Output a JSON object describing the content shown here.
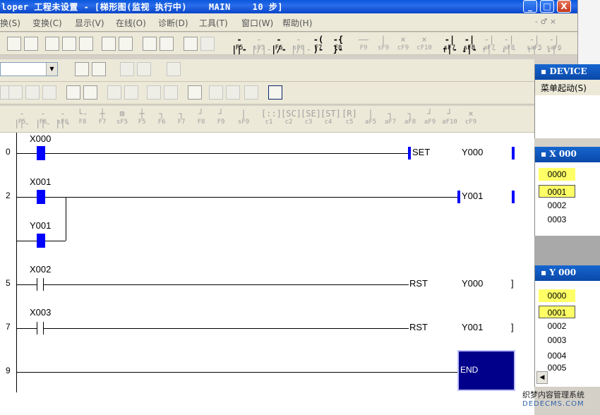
{
  "window": {
    "title": "loper 工程未设置 - [梯形图(监视 执行中)    MAIN    10 步]",
    "controls": {
      "minimize": "_",
      "maximize": "□",
      "close": "X"
    }
  },
  "menu": {
    "items": [
      "换(S)",
      "变换(C)",
      "显示(V)",
      "在线(O)",
      "诊断(D)",
      "工具(T)",
      "窗口(W)",
      "帮助(H)"
    ],
    "mdi_controls": "- ♂ ×"
  },
  "toolbar_fkeys": [
    {
      "sym": "-||-",
      "label": "F5",
      "enabled": true
    },
    {
      "sym": "-|/|-",
      "label": "sF5",
      "enabled": false
    },
    {
      "sym": "-|/-",
      "label": "F6",
      "enabled": true
    },
    {
      "sym": "-|/|-",
      "label": "sF6",
      "enabled": false
    },
    {
      "sym": "-( )-",
      "label": "F7",
      "enabled": true
    },
    {
      "sym": "-{ }-",
      "label": "F8",
      "enabled": true
    },
    {
      "sym": "——",
      "label": "F9",
      "enabled": false
    },
    {
      "sym": "|",
      "label": "sF9",
      "enabled": false
    },
    {
      "sym": "×",
      "label": "cF9",
      "enabled": false
    },
    {
      "sym": "×",
      "label": "cF10",
      "enabled": false
    },
    {
      "sym": "-|↑|-",
      "label": "sF7",
      "enabled": true
    },
    {
      "sym": "-|↓|-",
      "label": "sF8",
      "enabled": true
    },
    {
      "sym": "-|↑|-",
      "label": "aF7",
      "enabled": false
    },
    {
      "sym": "-|↓|-",
      "label": "aF8",
      "enabled": false
    },
    {
      "sym": "-|↑|-",
      "label": "saF5",
      "enabled": false
    },
    {
      "sym": "-|↓|-",
      "label": "saF6",
      "enabled": false
    }
  ],
  "toolbar_row4": [
    {
      "sym": "-||-",
      "label": "F5"
    },
    {
      "sym": "-||-",
      "label": "F6"
    },
    {
      "sym": "-||-",
      "label": "sF6"
    },
    {
      "sym": "└-",
      "label": "F8"
    },
    {
      "sym": "┼",
      "label": "F7"
    },
    {
      "sym": "⊠",
      "label": "sF5"
    },
    {
      "sym": "┼",
      "label": "F5"
    },
    {
      "sym": "┐",
      "label": "F6"
    },
    {
      "sym": "┐",
      "label": "F7"
    },
    {
      "sym": "┘",
      "label": "F8"
    },
    {
      "sym": "┘",
      "label": "F9"
    },
    {
      "sym": "|",
      "label": "sF9"
    },
    {
      "sym": "[::]",
      "label": "c1"
    },
    {
      "sym": "[SC]",
      "label": "c2"
    },
    {
      "sym": "[SE]",
      "label": "c3"
    },
    {
      "sym": "[ST]",
      "label": "c4"
    },
    {
      "sym": "[R]",
      "label": "c5"
    },
    {
      "sym": "|",
      "label": "aF5"
    },
    {
      "sym": "┐",
      "label": "aF7"
    },
    {
      "sym": "┐",
      "label": "aF8"
    },
    {
      "sym": "┘",
      "label": "aF9"
    },
    {
      "sym": "┘",
      "label": "aF10"
    },
    {
      "sym": "×",
      "label": "cF9"
    }
  ],
  "ladder": {
    "rungs": [
      {
        "step": "0",
        "contacts": [
          "X000"
        ],
        "instruction": "SET",
        "operand": "Y000"
      },
      {
        "step": "2",
        "contacts": [
          "X001",
          "Y001"
        ],
        "coil": "Y001"
      },
      {
        "step": "5",
        "contacts": [
          "X002"
        ],
        "instruction": "RST",
        "operand": "Y000"
      },
      {
        "step": "7",
        "contacts": [
          "X003"
        ],
        "instruction": "RST",
        "operand": "Y001"
      },
      {
        "step": "9",
        "instruction": "END"
      }
    ]
  },
  "device_panel": {
    "title": "DEVICE",
    "menu": "菜单起动(S)"
  },
  "x_panel": {
    "title": "X  000",
    "items": [
      "0000",
      "0001",
      "0002",
      "0003"
    ],
    "highlighted": [
      "0000",
      "0001"
    ]
  },
  "y_panel": {
    "title": "Y  000",
    "items": [
      "0000",
      "0001",
      "0002",
      "0003",
      "0004",
      "0005"
    ],
    "highlighted": [
      "0000",
      "0001"
    ]
  },
  "watermark": {
    "line1": "织梦内容管理系统",
    "line2": "DEDECMS.COM"
  },
  "colors": {
    "title_bar": "#0a58dc",
    "active_contact": "#0000ff",
    "end_box": "#00008b",
    "monitor_highlight": "#ffff66"
  }
}
